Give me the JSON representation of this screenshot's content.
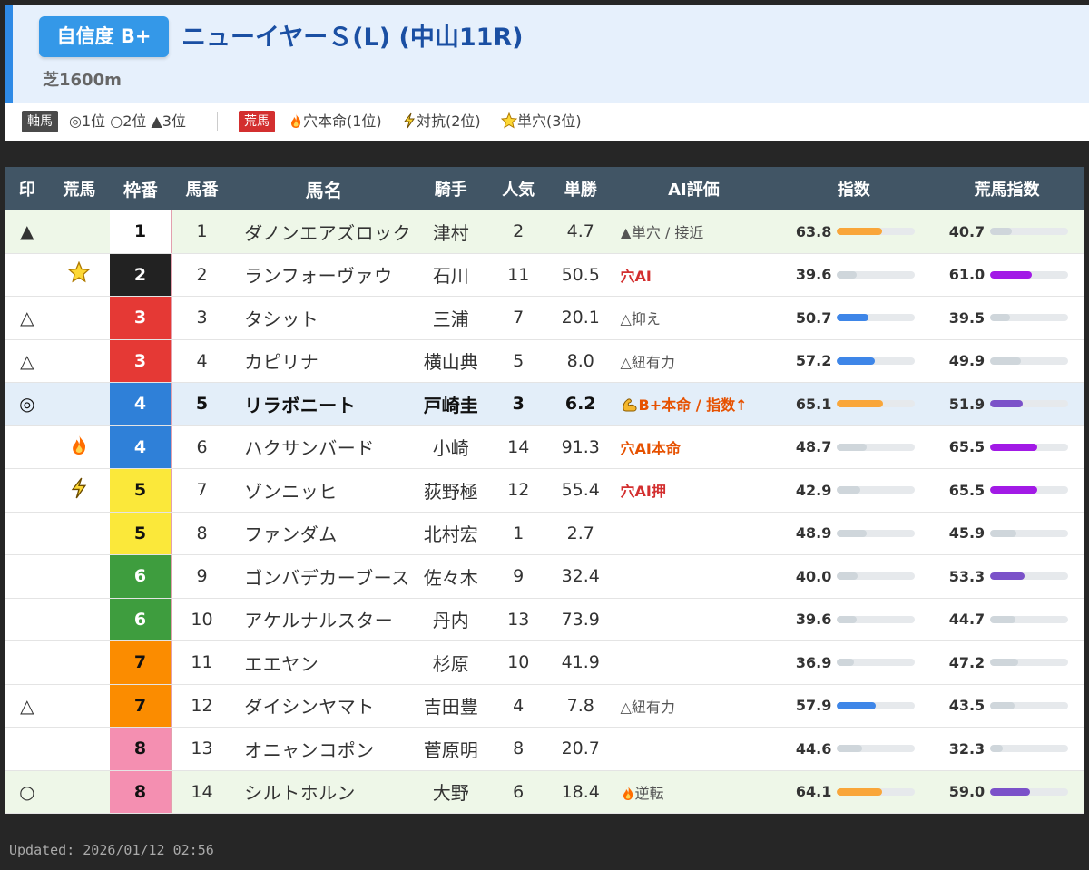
{
  "header": {
    "confidence": "自信度 B+",
    "race_title": "ニューイヤーＳ(L) (中山11R)",
    "course": "芝1600m"
  },
  "legend": {
    "axis_tag": "軸馬",
    "axis_text": "◎1位 ○2位 ▲3位",
    "ara_tag": "荒馬",
    "ara_1": "穴本命(1位)",
    "ara_2": "対抗(2位)",
    "ara_3": "単穴(3位)"
  },
  "columns": [
    "印",
    "荒馬",
    "枠番",
    "馬番",
    "馬名",
    "騎手",
    "人気",
    "単勝",
    "AI評価",
    "指数",
    "荒馬指数"
  ],
  "rows": [
    {
      "mark": "▲",
      "ara": "",
      "waku": "1",
      "uma": "1",
      "name": "ダノンエアズロック",
      "jockey": "津村",
      "pop": "2",
      "odds": "4.7",
      "ai": "▲単穴 / 接近",
      "ai_style": "gray",
      "idx": "63.8",
      "idx_v": 63.8,
      "idx_color": "#f9a63a",
      "ara_idx": "40.7",
      "ara_v": 40.7,
      "ara_color": "#cfd6db",
      "hl": "green"
    },
    {
      "mark": "",
      "ara": "star",
      "waku": "2",
      "uma": "2",
      "name": "ランフォーヴァウ",
      "jockey": "石川",
      "pop": "11",
      "odds": "50.5",
      "ai": "穴AI",
      "ai_style": "red",
      "idx": "39.6",
      "idx_v": 39.6,
      "idx_color": "#cfd6db",
      "ara_idx": "61.0",
      "ara_v": 61.0,
      "ara_color": "#a21ae6",
      "hl": ""
    },
    {
      "mark": "△",
      "ara": "",
      "waku": "3",
      "uma": "3",
      "name": "タシット",
      "jockey": "三浦",
      "pop": "7",
      "odds": "20.1",
      "ai": "△抑え",
      "ai_style": "gray",
      "idx": "50.7",
      "idx_v": 50.7,
      "idx_color": "#3e86e8",
      "ara_idx": "39.5",
      "ara_v": 39.5,
      "ara_color": "#cfd6db",
      "hl": ""
    },
    {
      "mark": "△",
      "ara": "",
      "waku": "3",
      "uma": "4",
      "name": "カピリナ",
      "jockey": "横山典",
      "pop": "5",
      "odds": "8.0",
      "ai": "△紐有力",
      "ai_style": "gray",
      "idx": "57.2",
      "idx_v": 57.2,
      "idx_color": "#3e86e8",
      "ara_idx": "49.9",
      "ara_v": 49.9,
      "ara_color": "#cfd6db",
      "hl": ""
    },
    {
      "mark": "◎",
      "ara": "",
      "waku": "4",
      "uma": "5",
      "name": "リラボニート",
      "jockey": "戸崎圭",
      "pop": "3",
      "odds": "6.2",
      "ai": "B+本命 / 指数↑",
      "ai_style": "orange-muscle",
      "idx": "65.1",
      "idx_v": 65.1,
      "idx_color": "#f9a63a",
      "ara_idx": "51.9",
      "ara_v": 51.9,
      "ara_color": "#7b52c9",
      "hl": "blue"
    },
    {
      "mark": "",
      "ara": "fire",
      "waku": "4",
      "uma": "6",
      "name": "ハクサンバード",
      "jockey": "小崎",
      "pop": "14",
      "odds": "91.3",
      "ai": "穴AI本命",
      "ai_style": "orange",
      "idx": "48.7",
      "idx_v": 48.7,
      "idx_color": "#cfd6db",
      "ara_idx": "65.5",
      "ara_v": 65.5,
      "ara_color": "#a21ae6",
      "hl": ""
    },
    {
      "mark": "",
      "ara": "bolt",
      "waku": "5",
      "uma": "7",
      "name": "ゾンニッヒ",
      "jockey": "荻野極",
      "pop": "12",
      "odds": "55.4",
      "ai": "穴AI押",
      "ai_style": "red",
      "idx": "42.9",
      "idx_v": 42.9,
      "idx_color": "#cfd6db",
      "ara_idx": "65.5",
      "ara_v": 65.5,
      "ara_color": "#a21ae6",
      "hl": ""
    },
    {
      "mark": "",
      "ara": "",
      "waku": "5",
      "uma": "8",
      "name": "ファンダム",
      "jockey": "北村宏",
      "pop": "1",
      "odds": "2.7",
      "ai": "",
      "ai_style": "gray",
      "idx": "48.9",
      "idx_v": 48.9,
      "idx_color": "#cfd6db",
      "ara_idx": "45.9",
      "ara_v": 45.9,
      "ara_color": "#cfd6db",
      "hl": ""
    },
    {
      "mark": "",
      "ara": "",
      "waku": "6",
      "uma": "9",
      "name": "ゴンバデカーブース",
      "jockey": "佐々木",
      "pop": "9",
      "odds": "32.4",
      "ai": "",
      "ai_style": "gray",
      "idx": "40.0",
      "idx_v": 40.0,
      "idx_color": "#cfd6db",
      "ara_idx": "53.3",
      "ara_v": 53.3,
      "ara_color": "#7b52c9",
      "hl": ""
    },
    {
      "mark": "",
      "ara": "",
      "waku": "6",
      "uma": "10",
      "name": "アケルナルスター",
      "jockey": "丹内",
      "pop": "13",
      "odds": "73.9",
      "ai": "",
      "ai_style": "gray",
      "idx": "39.6",
      "idx_v": 39.6,
      "idx_color": "#cfd6db",
      "ara_idx": "44.7",
      "ara_v": 44.7,
      "ara_color": "#cfd6db",
      "hl": ""
    },
    {
      "mark": "",
      "ara": "",
      "waku": "7",
      "uma": "11",
      "name": "エエヤン",
      "jockey": "杉原",
      "pop": "10",
      "odds": "41.9",
      "ai": "",
      "ai_style": "gray",
      "idx": "36.9",
      "idx_v": 36.9,
      "idx_color": "#cfd6db",
      "ara_idx": "47.2",
      "ara_v": 47.2,
      "ara_color": "#cfd6db",
      "hl": ""
    },
    {
      "mark": "△",
      "ara": "",
      "waku": "7",
      "uma": "12",
      "name": "ダイシンヤマト",
      "jockey": "吉田豊",
      "pop": "4",
      "odds": "7.8",
      "ai": "△紐有力",
      "ai_style": "gray",
      "idx": "57.9",
      "idx_v": 57.9,
      "idx_color": "#3e86e8",
      "ara_idx": "43.5",
      "ara_v": 43.5,
      "ara_color": "#cfd6db",
      "hl": ""
    },
    {
      "mark": "",
      "ara": "",
      "waku": "8",
      "uma": "13",
      "name": "オニャンコポン",
      "jockey": "菅原明",
      "pop": "8",
      "odds": "20.7",
      "ai": "",
      "ai_style": "gray",
      "idx": "44.6",
      "idx_v": 44.6,
      "idx_color": "#cfd6db",
      "ara_idx": "32.3",
      "ara_v": 32.3,
      "ara_color": "#cfd6db",
      "hl": ""
    },
    {
      "mark": "○",
      "ara": "",
      "waku": "8",
      "uma": "14",
      "name": "シルトホルン",
      "jockey": "大野",
      "pop": "6",
      "odds": "18.4",
      "ai": "逆転",
      "ai_style": "gray-fire",
      "idx": "64.1",
      "idx_v": 64.1,
      "idx_color": "#f9a63a",
      "ara_idx": "59.0",
      "ara_v": 59.0,
      "ara_color": "#7b52c9",
      "hl": "green"
    }
  ],
  "waku_colors": {
    "1": {
      "bg": "#ffffff",
      "fg": "#111111"
    },
    "2": {
      "bg": "#222222",
      "fg": "#ffffff"
    },
    "3": {
      "bg": "#e53935",
      "fg": "#ffffff"
    },
    "4": {
      "bg": "#2f80d8",
      "fg": "#ffffff"
    },
    "5": {
      "bg": "#fbe83a",
      "fg": "#111111"
    },
    "6": {
      "bg": "#3e9d3e",
      "fg": "#ffffff"
    },
    "7": {
      "bg": "#fb8c00",
      "fg": "#111111"
    },
    "8": {
      "bg": "#f48fb1",
      "fg": "#111111"
    }
  },
  "footer": {
    "updated": "Updated: 2026/01/12 02:56"
  }
}
